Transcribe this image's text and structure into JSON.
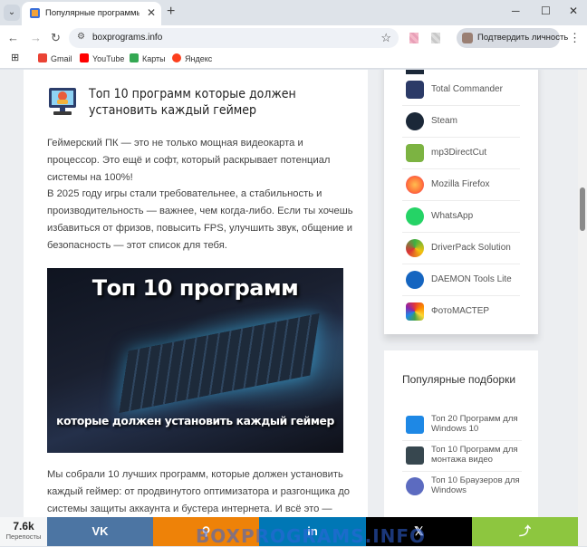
{
  "browser": {
    "tab_menu_icon": "chevron-down-icon",
    "tab_title": "Популярные программы для П",
    "tab_close": "✕",
    "new_tab": "+",
    "window_minimize": "─",
    "window_maximize": "☐",
    "window_close": "✕",
    "back": "←",
    "forward": "→",
    "reload": "↻",
    "url": "boxprograms.info",
    "site_info_icon": "tune-icon",
    "bookmark_star": "☆",
    "profile_label": "Подтвердить личность",
    "menu": "⋮"
  },
  "bookmarks_bar": {
    "apps_icon": "⊞",
    "items": [
      "Gmail",
      "YouTube",
      "Карты",
      "Яндекс"
    ]
  },
  "article": {
    "title": "Топ 10 программ которые должен установить каждый геймер",
    "intro_p1": "Геймерский ПК — это не только мощная видеокарта и процессор. Это ещё и софт, который раскрывает потенциал системы на 100%!",
    "intro_p2": "В 2025 году игры стали требовательнее, а стабильность и производительность — важнее, чем когда-либо. Если ты хочешь избавиться от фризов, повысить FPS, улучшить звук, общение и безопасность — этот список для тебя.",
    "banner_line1": "Топ 10 программ",
    "banner_line2": "которые должен установить каждый геймер",
    "outro": "Мы собрали 10 лучших программ, которые должен установить каждый геймер: от продвинутого оптимизатора и разгонщика до системы защиты аккаунта и бустера интернета. И всё это —"
  },
  "sidebar": {
    "programs": [
      {
        "label": "Total Commander",
        "icon": "floppy-disk-icon",
        "color": "#2b3a67"
      },
      {
        "label": "Steam",
        "icon": "steam-icon",
        "color": "#1b2838"
      },
      {
        "label": "mp3DirectCut",
        "icon": "audio-edit-icon",
        "color": "#7cb342"
      },
      {
        "label": "Mozilla Firefox",
        "icon": "firefox-icon",
        "color": "#ff7139"
      },
      {
        "label": "WhatsApp",
        "icon": "whatsapp-icon",
        "color": "#25d366"
      },
      {
        "label": "DriverPack Solution",
        "icon": "driverpack-icon",
        "color": "#3cb043"
      },
      {
        "label": "DAEMON Tools Lite",
        "icon": "daemon-tools-icon",
        "color": "#1565c0"
      },
      {
        "label": "ФотоМАСТЕР",
        "icon": "fotomaster-icon",
        "color": "#e53935"
      }
    ],
    "popular_title": "Популярные подборки",
    "popular": [
      {
        "label": "Топ 20 Программ для Windows 10",
        "icon": "windows-icon",
        "color": "#1e88e5"
      },
      {
        "label": "Топ 10 Программ для монтажа видео",
        "icon": "film-icon",
        "color": "#37474f"
      },
      {
        "label": "Топ 10 Браузеров для Windows",
        "icon": "globe-icon",
        "color": "#5c6bc0"
      }
    ]
  },
  "share": {
    "count": "7.6k",
    "count_label": "Перепосты",
    "buttons": [
      {
        "label": "vk",
        "color": "#4c75a3"
      },
      {
        "label": "ok",
        "color": "#ee8208"
      },
      {
        "label": "in",
        "color": "#0077b5"
      },
      {
        "label": "X",
        "color": "#000000"
      },
      {
        "label": "share",
        "color": "#8dc63f"
      }
    ],
    "vk_text": "VK",
    "ok_text": "⚲",
    "in_text": "in",
    "x_text": "𝕏",
    "share_text": "⤴"
  },
  "watermark": "BOXPROGRAMS.INFO"
}
